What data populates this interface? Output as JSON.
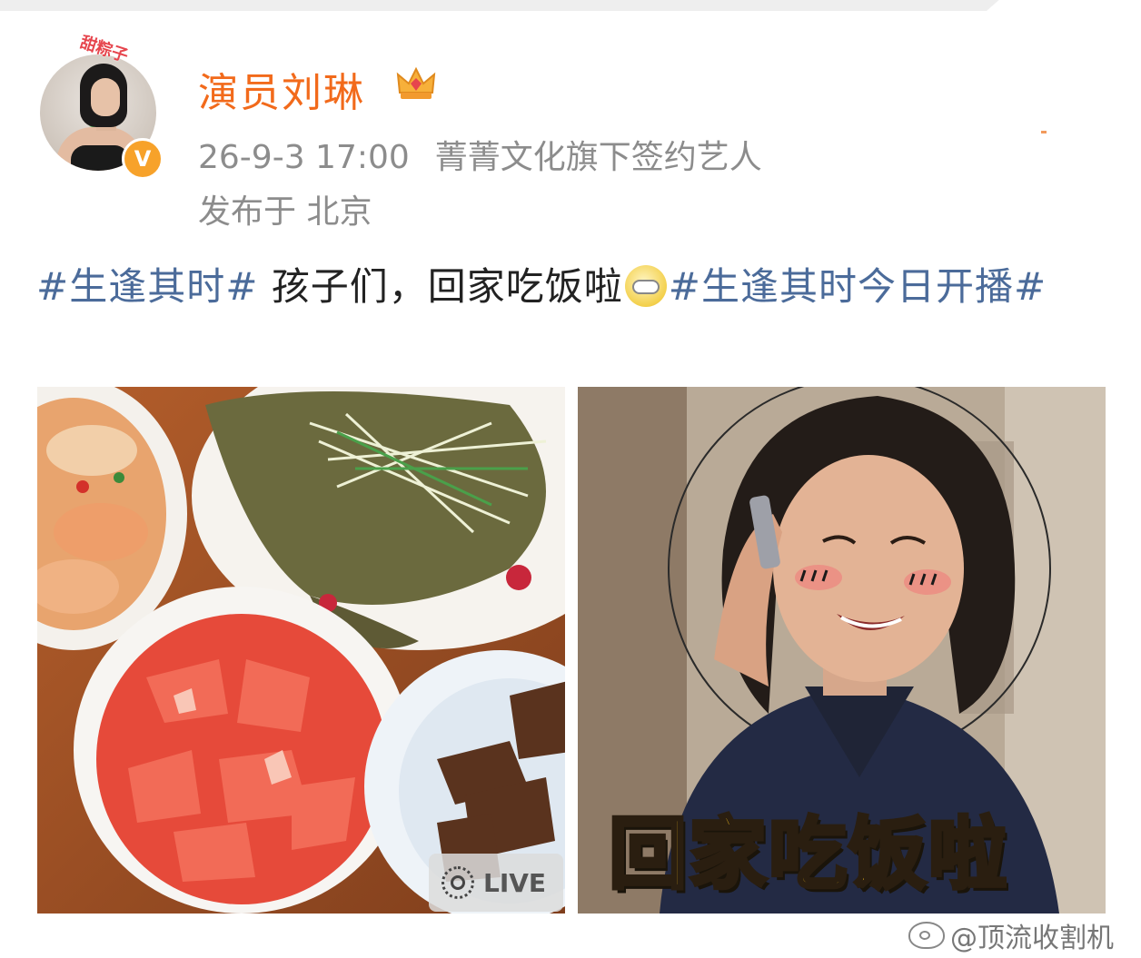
{
  "post": {
    "avatar_sticker": "甜粽子",
    "username": "演员刘琳",
    "timestamp": "26-9-3 17:00",
    "source": "菁菁文化旗下签约艺人",
    "location_prefix": "发布于",
    "location": "北京",
    "text": {
      "hashtag1": "#生逢其时#",
      "body1": " 孩子们，回家吃饭啦",
      "hashtag2": "#生逢其时今日开播#"
    }
  },
  "media": {
    "live_label": "LIVE",
    "banner_text": "回家吃饭啦"
  },
  "watermark": {
    "text": "@顶流收割机"
  },
  "icons": [
    "verified-badge-icon",
    "crown-icon",
    "emoji-icon",
    "live-photo-icon",
    "weibo-logo-icon"
  ],
  "colors": {
    "username": "#f26a1b",
    "hashtag": "#4b6b9a",
    "meta": "#8c8c8c",
    "verified": "#f7a22a",
    "banner": "#ffc71f"
  }
}
